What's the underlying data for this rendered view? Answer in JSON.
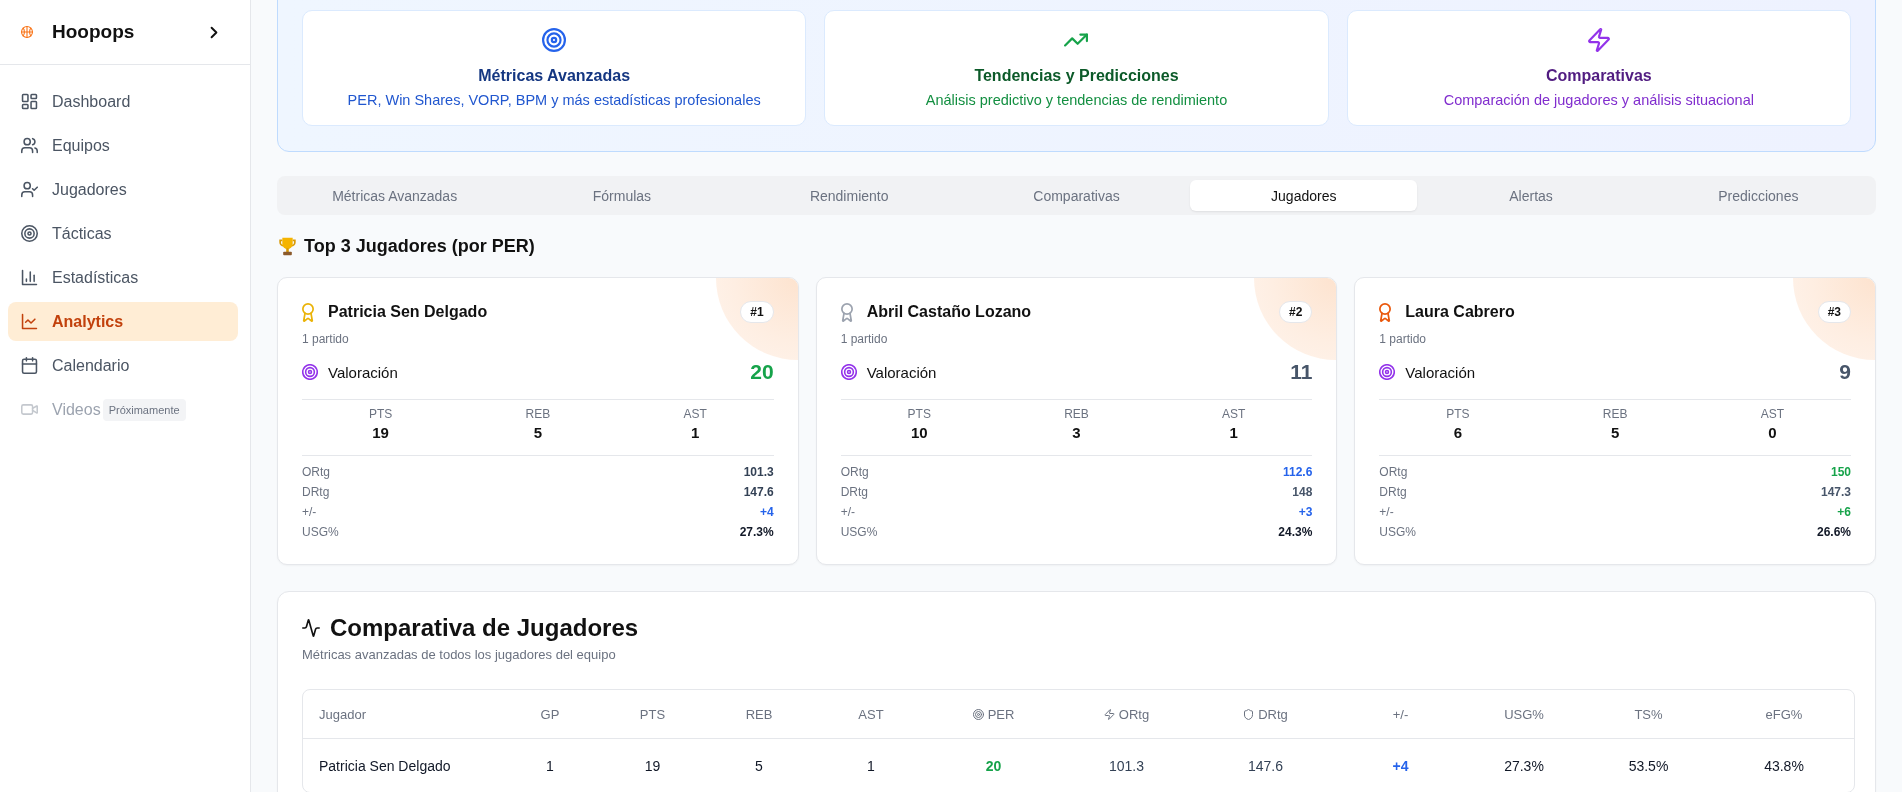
{
  "sidebar": {
    "brand": "Hoopops",
    "items": [
      {
        "label": "Dashboard",
        "selected": false,
        "disabled": false
      },
      {
        "label": "Equipos",
        "selected": false,
        "disabled": false
      },
      {
        "label": "Jugadores",
        "selected": false,
        "disabled": false
      },
      {
        "label": "Tácticas",
        "selected": false,
        "disabled": false
      },
      {
        "label": "Estadísticas",
        "selected": false,
        "disabled": false
      },
      {
        "label": "Analytics",
        "selected": true,
        "disabled": false
      },
      {
        "label": "Calendario",
        "selected": false,
        "disabled": false
      },
      {
        "label": "Videos",
        "selected": false,
        "disabled": true,
        "badge": "Próximamente"
      }
    ]
  },
  "feature_cards": [
    {
      "title": "Métricas Avanzadas",
      "description": "PER, Win Shares, VORP, BPM y más estadísticas profesionales",
      "color": "#2563eb"
    },
    {
      "title": "Tendencias y Predicciones",
      "description": "Análisis predictivo y tendencias de rendimiento",
      "color": "#16a34a"
    },
    {
      "title": "Comparativas",
      "description": "Comparación de jugadores y análisis situacional",
      "color": "#9333ea"
    }
  ],
  "tabs": [
    {
      "label": "Métricas Avanzadas",
      "selected": false
    },
    {
      "label": "Fórmulas",
      "selected": false
    },
    {
      "label": "Rendimiento",
      "selected": false
    },
    {
      "label": "Comparativas",
      "selected": false
    },
    {
      "label": "Jugadores",
      "selected": true
    },
    {
      "label": "Alertas",
      "selected": false
    },
    {
      "label": "Predicciones",
      "selected": false
    }
  ],
  "top_players": {
    "title": "Top 3 Jugadores (por PER)",
    "players": [
      {
        "name": "Patricia Sen Delgado",
        "rank": "#1",
        "games": "1 partido",
        "medal": {
          "color": "#eab308"
        },
        "rating": {
          "label": "Valoración",
          "value": "20",
          "color": "#16a34a"
        },
        "stats": [
          {
            "label": "PTS",
            "value": "19"
          },
          {
            "label": "REB",
            "value": "5"
          },
          {
            "label": "AST",
            "value": "1"
          }
        ],
        "metrics": [
          {
            "label": "ORtg",
            "value": "101.3",
            "color": "#334155"
          },
          {
            "label": "DRtg",
            "value": "147.6",
            "color": "#334155"
          },
          {
            "label": "+/-",
            "value": "+4",
            "color": "#2563eb"
          },
          {
            "label": "USG%",
            "value": "27.3%",
            "color": "#111827"
          }
        ]
      },
      {
        "name": "Abril Castaño Lozano",
        "rank": "#2",
        "games": "1 partido",
        "medal": {
          "color": "#9ca3af"
        },
        "rating": {
          "label": "Valoración",
          "value": "11",
          "color": "#475569"
        },
        "stats": [
          {
            "label": "PTS",
            "value": "10"
          },
          {
            "label": "REB",
            "value": "3"
          },
          {
            "label": "AST",
            "value": "1"
          }
        ],
        "metrics": [
          {
            "label": "ORtg",
            "value": "112.6",
            "color": "#2563eb"
          },
          {
            "label": "DRtg",
            "value": "148",
            "color": "#475569"
          },
          {
            "label": "+/-",
            "value": "+3",
            "color": "#2563eb"
          },
          {
            "label": "USG%",
            "value": "24.3%",
            "color": "#111827"
          }
        ]
      },
      {
        "name": "Laura Cabrero",
        "rank": "#3",
        "games": "1 partido",
        "medal": {
          "color": "#ea580c"
        },
        "rating": {
          "label": "Valoración",
          "value": "9",
          "color": "#475569"
        },
        "stats": [
          {
            "label": "PTS",
            "value": "6"
          },
          {
            "label": "REB",
            "value": "5"
          },
          {
            "label": "AST",
            "value": "0"
          }
        ],
        "metrics": [
          {
            "label": "ORtg",
            "value": "150",
            "color": "#16a34a"
          },
          {
            "label": "DRtg",
            "value": "147.3",
            "color": "#475569"
          },
          {
            "label": "+/-",
            "value": "+6",
            "color": "#16a34a"
          },
          {
            "label": "USG%",
            "value": "26.6%",
            "color": "#111827"
          }
        ]
      }
    ]
  },
  "comparison": {
    "title": "Comparativa de Jugadores",
    "subtitle": "Métricas avanzadas de todos los jugadores del equipo",
    "table": {
      "columns": [
        "Jugador",
        "GP",
        "PTS",
        "REB",
        "AST",
        "PER",
        "ORtg",
        "DRtg",
        "+/-",
        "USG%",
        "TS%",
        "eFG%"
      ],
      "rows": [
        {
          "cells": [
            {
              "text": "Patricia Sen Delgado",
              "color": "#111827"
            },
            {
              "text": "1",
              "color": "#111827"
            },
            {
              "text": "19",
              "color": "#111827"
            },
            {
              "text": "5",
              "color": "#111827"
            },
            {
              "text": "1",
              "color": "#111827"
            },
            {
              "text": "20",
              "color": "#16a34a"
            },
            {
              "text": "101.3",
              "color": "#334155"
            },
            {
              "text": "147.6",
              "color": "#334155"
            },
            {
              "text": "+4",
              "color": "#2563eb"
            },
            {
              "text": "27.3%",
              "color": "#111827"
            },
            {
              "text": "53.5%",
              "color": "#111827"
            },
            {
              "text": "43.8%",
              "color": "#111827"
            }
          ]
        }
      ]
    }
  }
}
